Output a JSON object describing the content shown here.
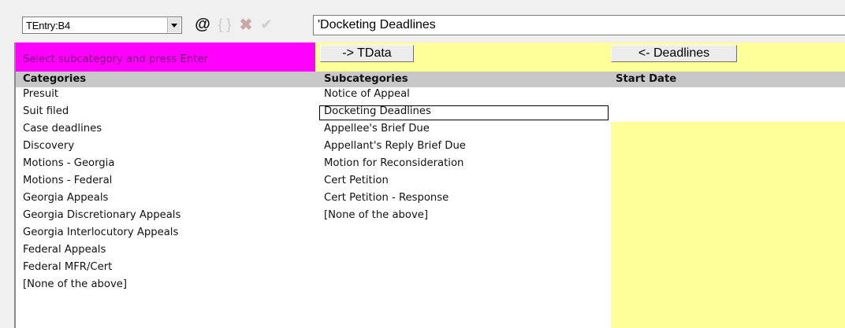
{
  "toolbar": {
    "name_box": "TEntry:B4",
    "formula_value": "'Docketing Deadlines",
    "icons": [
      "at-icon",
      "braces-icon",
      "cancel-x-icon",
      "confirm-check-icon"
    ],
    "icon_glyphs": {
      "at": "@",
      "braces": "{ }",
      "cancel": "✖",
      "confirm": "✔"
    }
  },
  "sheet": {
    "prompt": "Select subcategory and press Enter",
    "buttons": {
      "to_tdata": "-> TData",
      "to_deadlines": "<- Deadlines"
    },
    "headers": {
      "categories": "Categories",
      "subcategories": "Subcategories",
      "start_date": "Start Date"
    },
    "categories": [
      "Presuit",
      "Suit filed",
      "Case deadlines",
      "Discovery",
      "Motions - Georgia",
      "Motions - Federal",
      "Georgia Appeals",
      "Georgia Discretionary Appeals",
      "Georgia Interlocutory Appeals",
      "Federal Appeals",
      "Federal MFR/Cert",
      "[None of the above]"
    ],
    "subcategories": [
      "Notice of Appeal",
      "Docketing Deadlines",
      "Appellee's Brief Due",
      "Appellant's Reply Brief Due",
      "Motion for Reconsideration",
      "Cert Petition",
      "Cert Petition - Response",
      "[None of the above]"
    ],
    "selected_subcategory": "Docketing Deadlines"
  },
  "colors": {
    "prompt_bg": "#ff00ff",
    "prompt_text": "#7a007a",
    "yellow": "#ffff99",
    "header_bg": "#c8c8c8"
  }
}
